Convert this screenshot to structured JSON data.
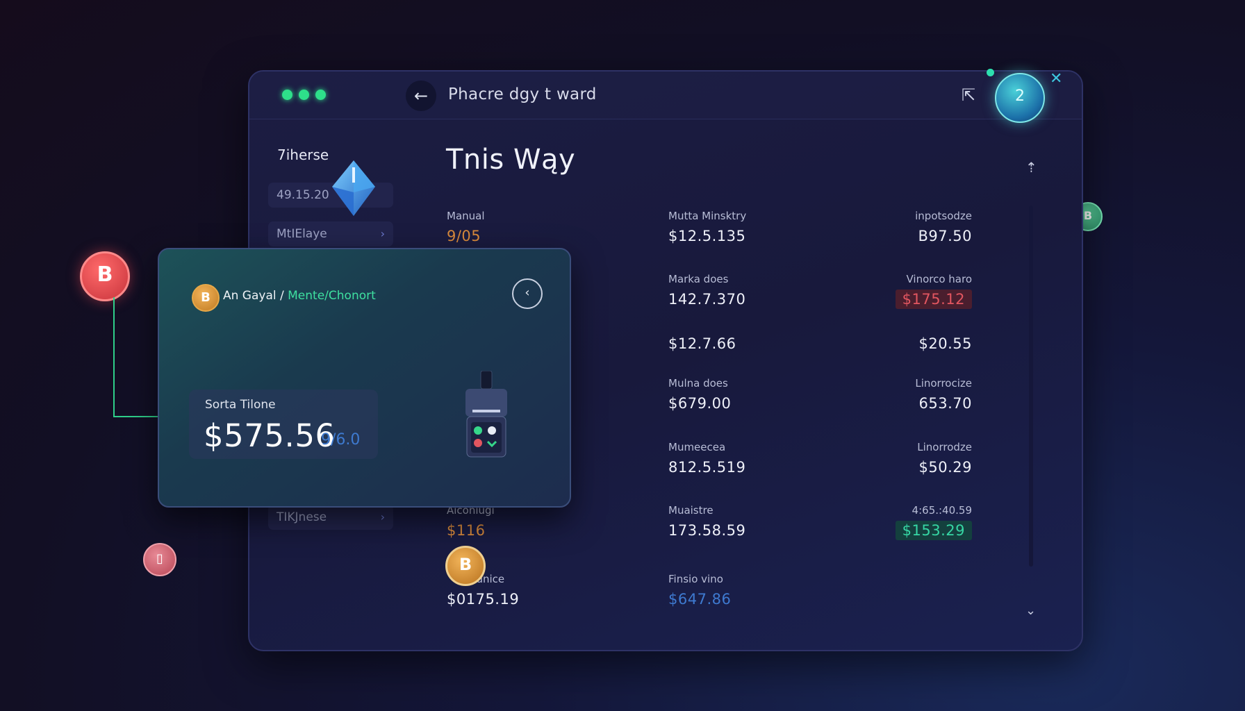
{
  "window": {
    "title": "Phacre dgy t ward",
    "avatar_label": "2"
  },
  "sidebar": {
    "title": "7iherse",
    "items": [
      {
        "label": "49.15.20"
      },
      {
        "label": "MtIElaye"
      },
      {
        "label": "TIKJnese"
      }
    ]
  },
  "main": {
    "title": "Tnis Wąy",
    "rows": [
      [
        {
          "label": "Manual",
          "value": "9/05",
          "style": "orange"
        },
        {
          "label": "Mutta Minsktry",
          "value": "$12.5.135"
        },
        {
          "label": "inpotsodze",
          "value": "B97.50"
        }
      ],
      [
        {
          "label": "",
          "value": ""
        },
        {
          "label": "Marka does",
          "value": "142.7.370"
        },
        {
          "label": "Vinorco haro",
          "value": "$175.12",
          "style": "badge-red"
        }
      ],
      [
        {
          "label": "",
          "value": ""
        },
        {
          "label": "",
          "value": "$12.7.66"
        },
        {
          "label": "",
          "value": "$20.55"
        }
      ],
      [
        {
          "label": "",
          "value": ""
        },
        {
          "label": "Mulna does",
          "value": "$679.00"
        },
        {
          "label": "Linorrocize",
          "value": "653.70"
        }
      ],
      [
        {
          "label": "",
          "value": ""
        },
        {
          "label": "Mumeecea",
          "value": "812.5.519"
        },
        {
          "label": "Linorrodze",
          "value": "$50.29"
        }
      ],
      [
        {
          "label": "Aiconiugi",
          "value": "$116",
          "style": "orange"
        },
        {
          "label": "Muaistre",
          "value": "173.58.59"
        },
        {
          "label": "4:65.:40.59",
          "value": "$153.29",
          "style": "badge-green"
        }
      ],
      [
        {
          "label": "Faunice",
          "value": "$0175.19"
        },
        {
          "label": "Finsio vino",
          "value": "$647.86",
          "style": "blue"
        },
        {
          "label": "",
          "value": ""
        }
      ]
    ]
  },
  "card": {
    "crumb_main": "An Gayal /",
    "crumb_accent": "Mente/Chonort",
    "balance_label": "Sorta Tilone",
    "balance_value": "$575.56",
    "balance_sub": "9/6.0"
  },
  "icons": {
    "coin_glyph": "B",
    "back_glyph": "←",
    "card_back_glyph": "‹",
    "share_glyph": "⇱",
    "close_glyph": "✕",
    "upload_glyph": "⇡",
    "down_glyph": "⌄",
    "chevron_glyph": "›"
  },
  "colors": {
    "accent_green": "#2ee08a",
    "negative_red": "#e25660",
    "positive_teal": "#36d6a4",
    "bitcoin_orange": "#e6a848"
  }
}
